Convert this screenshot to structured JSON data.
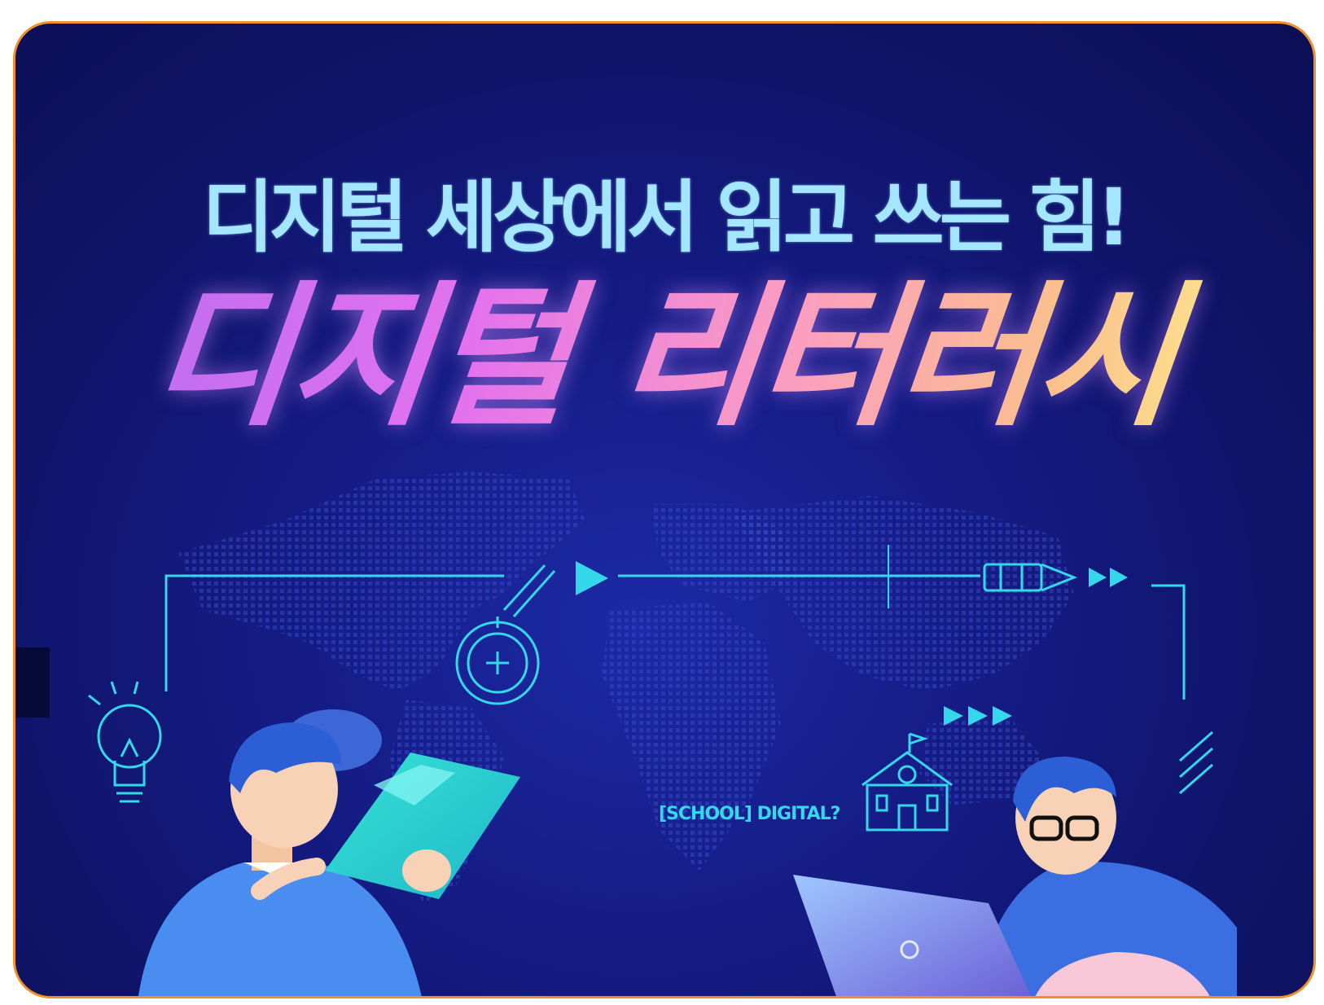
{
  "banner": {
    "subtitle": "디지털 세상에서 읽고 쓰는 힘!",
    "title": "디지털 리터러시",
    "school_label": "[SCHOOL] DIGITAL?"
  },
  "icons": [
    "lightbulb-icon",
    "target-icon",
    "play-arrow-icon",
    "pencil-icon",
    "fast-forward-icon",
    "school-building-icon"
  ],
  "colors": {
    "background": "#121883",
    "border": "#f0902a",
    "subtitle": "#a4e6ff",
    "accent": "#35d8ea",
    "title_gradient": [
      "#b36cf2",
      "#e472ee",
      "#fb9ec0",
      "#fbc08d",
      "#fdf58c"
    ]
  }
}
